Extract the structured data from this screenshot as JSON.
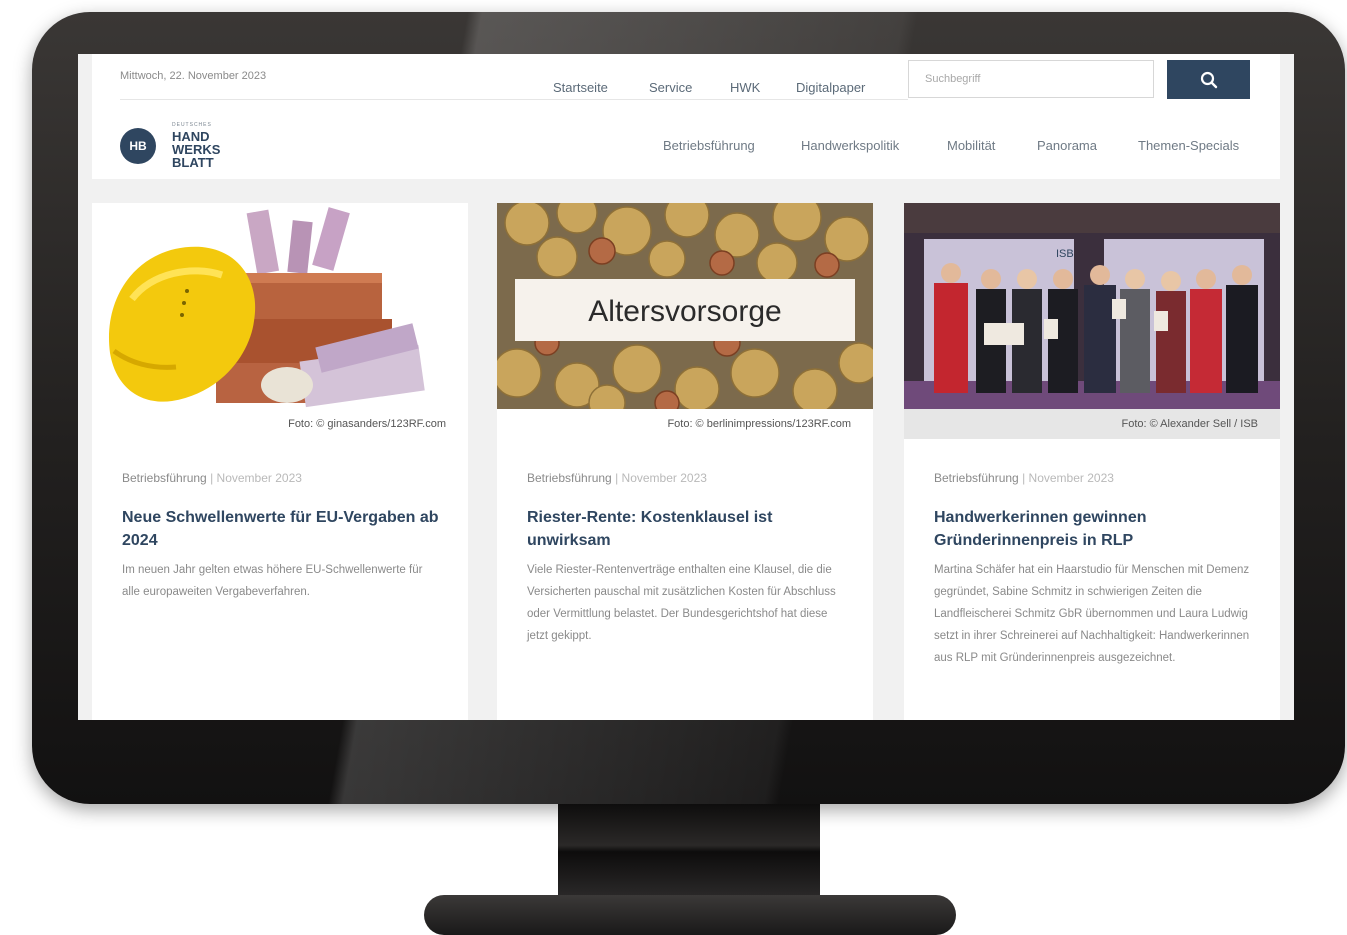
{
  "header": {
    "date": "Mittwoch, 22. November 2023",
    "top_nav": [
      "Startseite",
      "Service",
      "HWK",
      "Digitalpaper"
    ],
    "search": {
      "placeholder": "Suchbegriff",
      "icon": "search-icon"
    },
    "logo": {
      "mark": "HB",
      "small": "DEUTSCHES",
      "lines": [
        "HAND",
        "WERKS",
        "BLATT"
      ]
    },
    "main_nav": [
      "Betriebsführung",
      "Handwerkspolitik",
      "Mobilität",
      "Panorama",
      "Themen-Specials"
    ]
  },
  "colors": {
    "brand": "#2f4660",
    "text_muted": "#8a8a8a",
    "frame": "#242221"
  },
  "cards": [
    {
      "credit": "Foto: © ginasanders/123RF.com",
      "category": "Betriebsführung",
      "date": "November 2023",
      "title": "Neue Schwellenwerte für EU-Vergaben ab 2024",
      "teaser": "Im neuen Jahr gelten etwas höhere EU-Schwellenwerte für alle europaweiten Vergabeverfahren."
    },
    {
      "credit": "Foto: © berlinimpressions/123RF.com",
      "image_text": "Altersvorsorge",
      "category": "Betriebsführung",
      "date": "November 2023",
      "title": "Riester-Rente: Kostenklausel ist unwirksam",
      "teaser": "Viele Riester-Rentenverträge enthalten eine Klausel, die die Versicherten pauschal mit zusätzlichen Kosten für Abschluss oder Vermittlung belastet. Der Bundesgerichtshof hat diese jetzt gekippt."
    },
    {
      "credit": "Foto: © Alexander Sell / ISB",
      "image_text": "ISB",
      "category": "Betriebsführung",
      "date": "November 2023",
      "title": "Handwerkerinnen gewinnen Gründerinnenpreis in RLP",
      "teaser": "Martina Schäfer hat ein Haarstudio für Menschen mit Demenz gegründet, Sabine Schmitz in schwierigen Zeiten die Landfleischerei Schmitz GbR übernommen und Laura Ludwig setzt in ihrer Schreinerei auf Nachhaltigkeit: Handwerkerinnen aus RLP mit Gründerinnenpreis ausgezeichnet."
    }
  ],
  "separator": "|"
}
